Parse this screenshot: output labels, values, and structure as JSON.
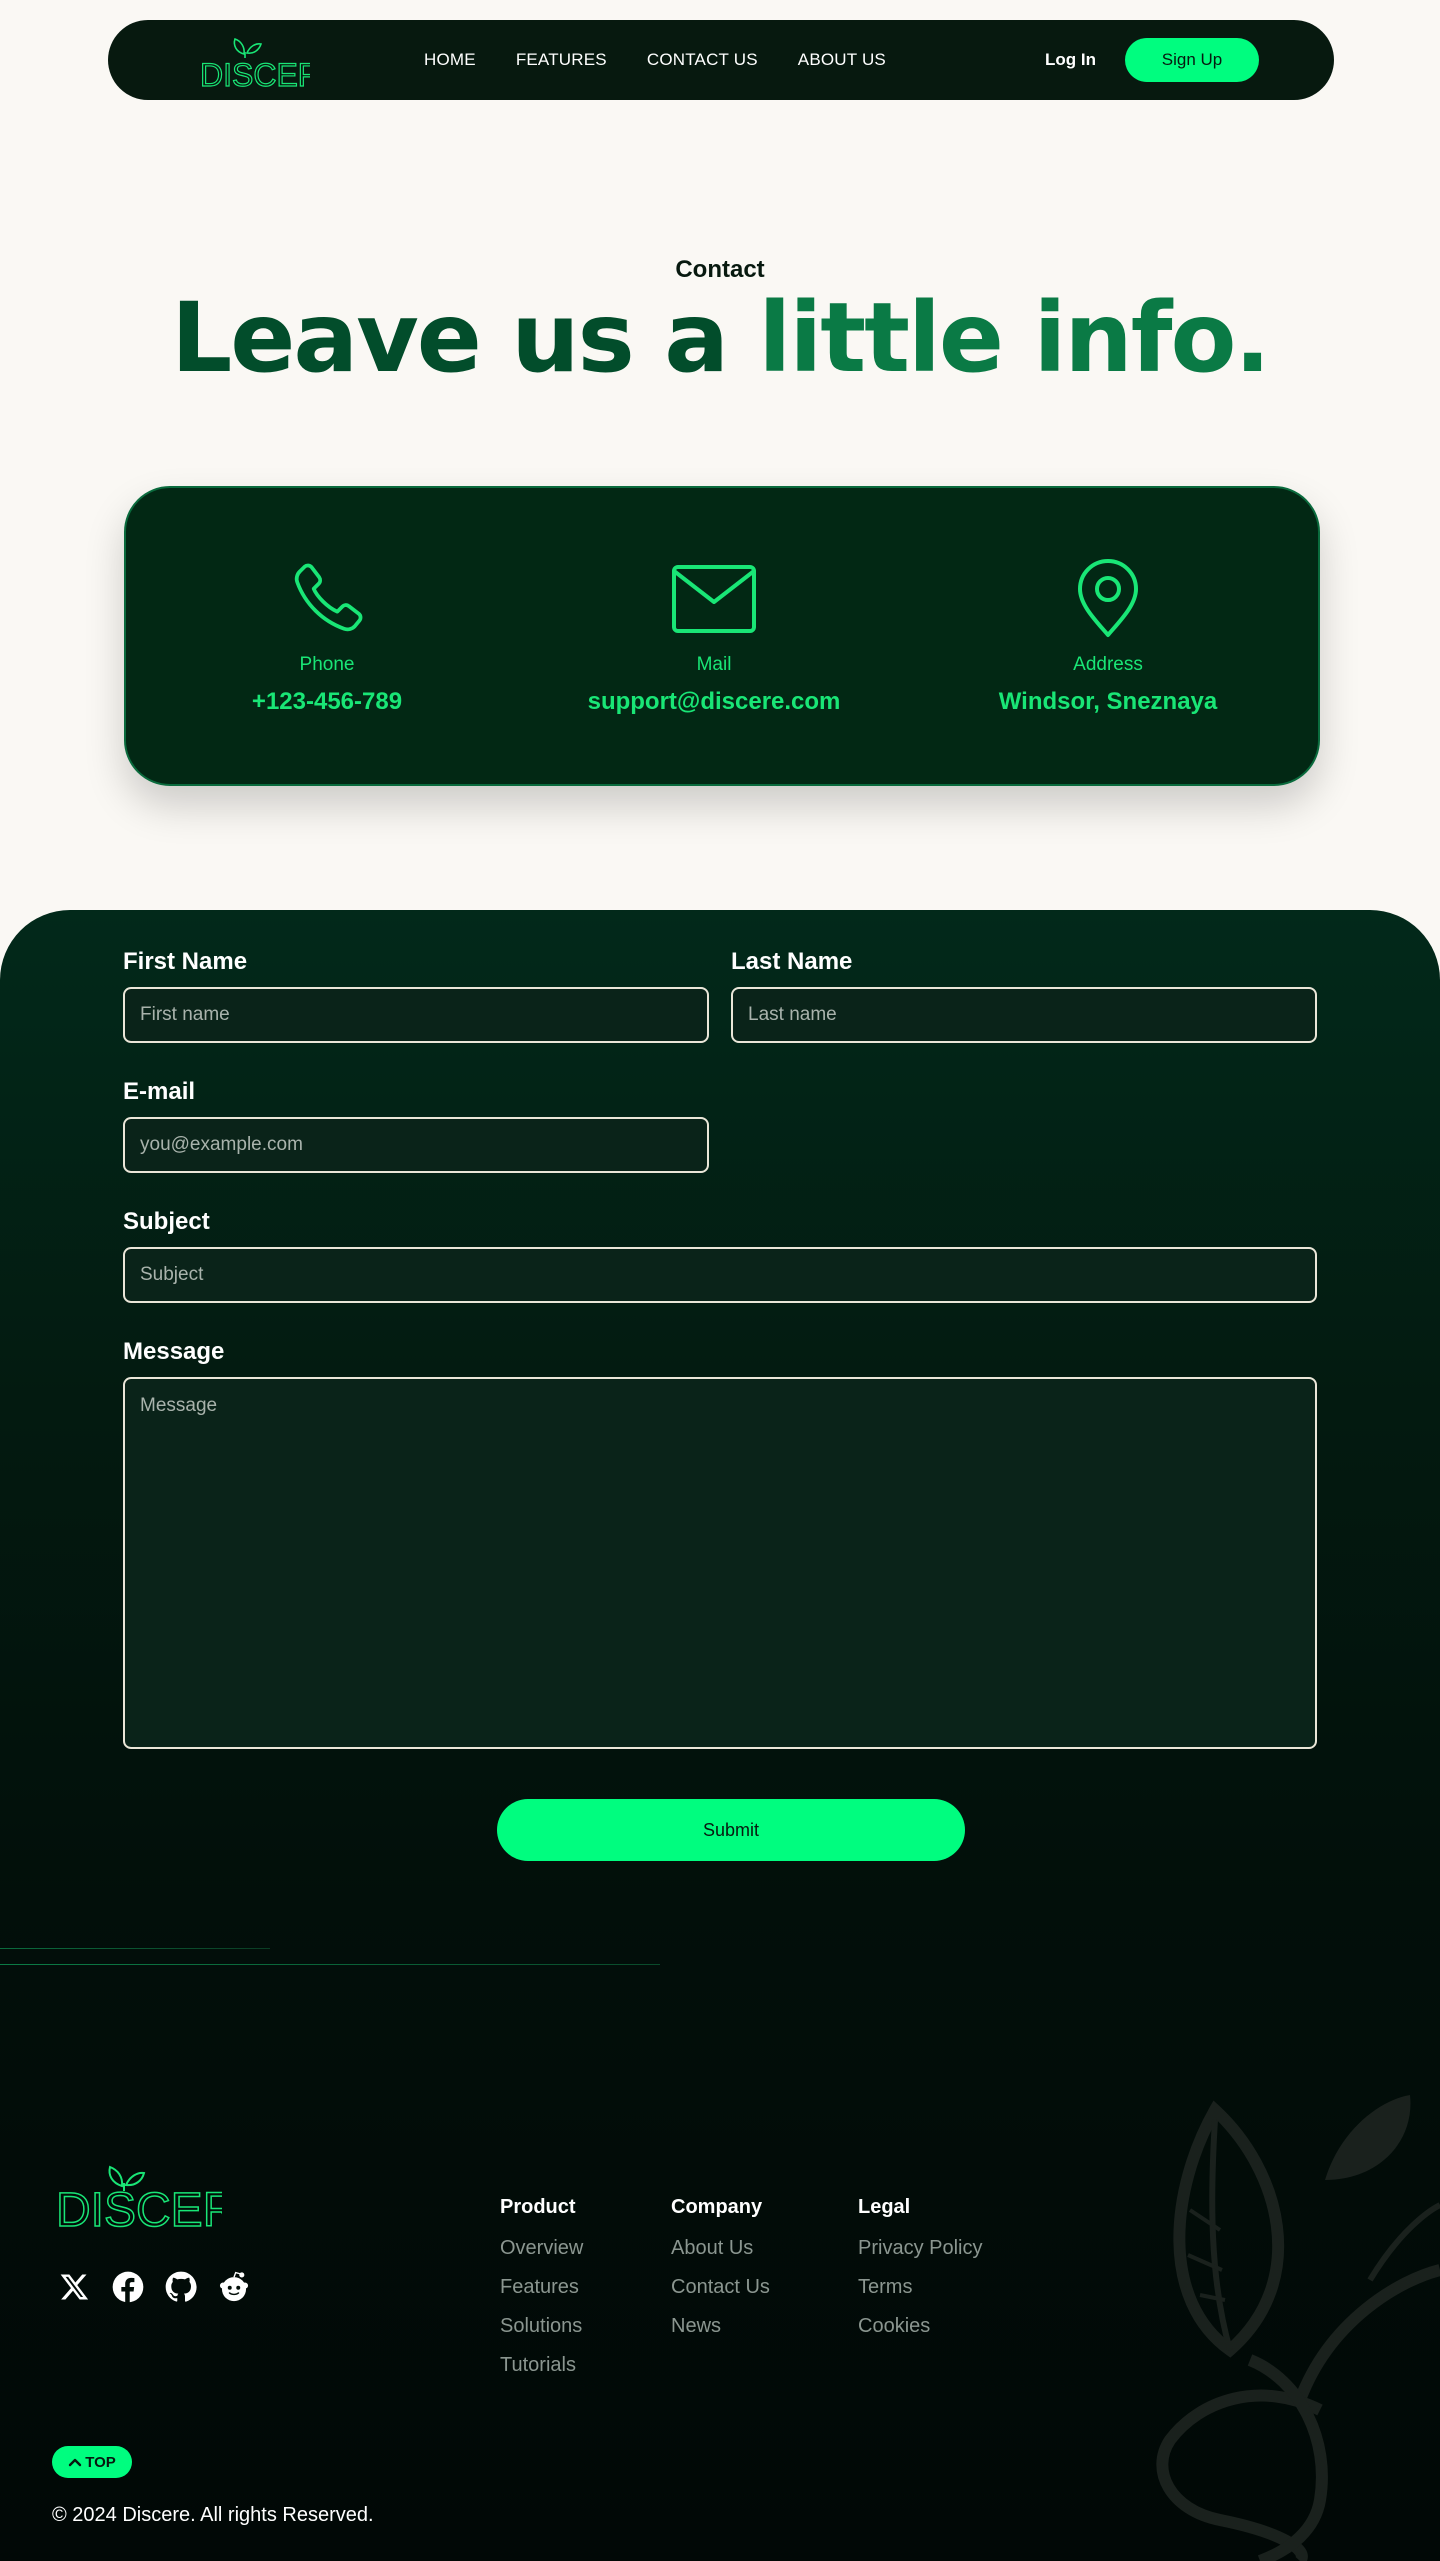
{
  "brand": {
    "name": "DISCERE",
    "accent": "#00fd7f",
    "dark": "#07190f"
  },
  "nav": {
    "links": [
      "HOME",
      "FEATURES",
      "CONTACT US",
      "ABOUT US"
    ],
    "login": "Log In",
    "signup": "Sign Up"
  },
  "hero": {
    "eyebrow": "Contact",
    "headline_part1": "Leave us a ",
    "headline_part2": "little info."
  },
  "contact_info": [
    {
      "icon": "phone-icon",
      "label": "Phone",
      "value": "+123-456-789"
    },
    {
      "icon": "mail-icon",
      "label": "Mail",
      "value": "support@discere.com"
    },
    {
      "icon": "location-pin-icon",
      "label": "Address",
      "value": "Windsor, Sneznaya"
    }
  ],
  "form": {
    "first_name": {
      "label": "First Name",
      "placeholder": "First name",
      "value": ""
    },
    "last_name": {
      "label": "Last Name",
      "placeholder": "Last name",
      "value": ""
    },
    "email": {
      "label": "E-mail",
      "placeholder": "you@example.com",
      "value": ""
    },
    "subject": {
      "label": "Subject",
      "placeholder": "Subject",
      "value": ""
    },
    "message": {
      "label": "Message",
      "placeholder": "Message",
      "value": ""
    },
    "submit": "Submit"
  },
  "footer": {
    "socials": [
      "x-icon",
      "facebook-icon",
      "github-icon",
      "reddit-icon"
    ],
    "columns": [
      {
        "title": "Product",
        "links": [
          "Overview",
          "Features",
          "Solutions",
          "Tutorials"
        ]
      },
      {
        "title": "Company",
        "links": [
          "About Us",
          "Contact Us",
          "News"
        ]
      },
      {
        "title": "Legal",
        "links": [
          "Privacy Policy",
          "Terms",
          "Cookies"
        ]
      }
    ],
    "top_button": "TOP",
    "copyright": "© 2024   Discere. All rights Reserved."
  }
}
